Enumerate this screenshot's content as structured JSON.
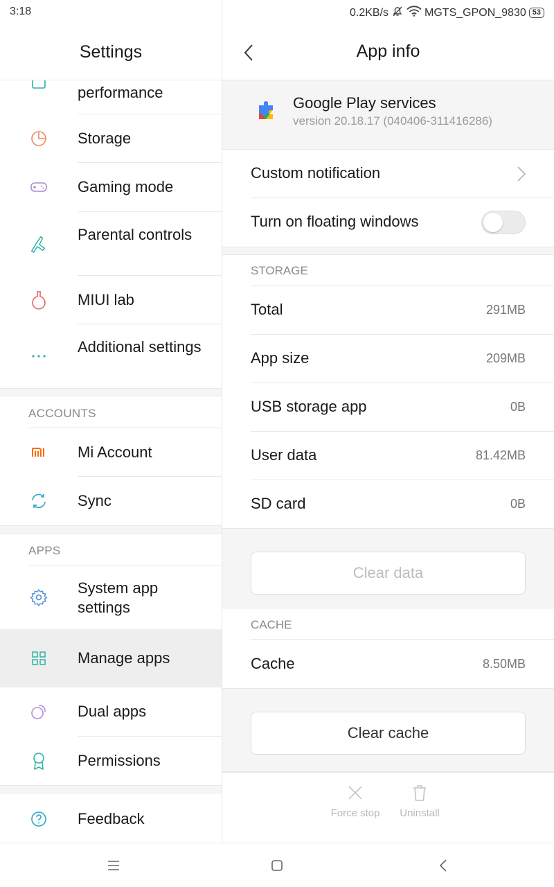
{
  "status_bar": {
    "time": "3:18",
    "speed": "0.2KB/s",
    "network": "MGTS_GPON_9830",
    "battery": "53"
  },
  "settings": {
    "title": "Settings",
    "items_top": [
      {
        "label": "performance",
        "icon": "battery-performance-icon"
      },
      {
        "label": "Storage",
        "icon": "storage-pie-icon"
      },
      {
        "label": "Gaming mode",
        "icon": "gamepad-icon"
      },
      {
        "label": "Parental controls",
        "icon": "parental-controls-icon"
      },
      {
        "label": "MIUI lab",
        "icon": "flask-icon"
      },
      {
        "label": "Additional settings",
        "icon": "more-dots-icon"
      }
    ],
    "accounts_header": "ACCOUNTS",
    "accounts": [
      {
        "label": "Mi Account",
        "icon": "mi-logo-icon"
      },
      {
        "label": "Sync",
        "icon": "sync-icon"
      }
    ],
    "apps_header": "APPS",
    "apps": [
      {
        "label": "System app settings",
        "icon": "gear-icon"
      },
      {
        "label": "Manage apps",
        "icon": "grid-icon"
      },
      {
        "label": "Dual apps",
        "icon": "dual-apps-icon"
      },
      {
        "label": "Permissions",
        "icon": "permissions-badge-icon"
      }
    ],
    "feedback": {
      "label": "Feedback",
      "icon": "question-icon"
    }
  },
  "app_info": {
    "title": "App  info",
    "app_name": "Google Play services",
    "version": "version 20.18.17 (040406-311416286)",
    "custom_notification": "Custom notification",
    "floating_windows": "Turn on floating windows",
    "floating_windows_on": false,
    "storage_header": "STORAGE",
    "storage": [
      {
        "label": "Total",
        "value": "291MB"
      },
      {
        "label": "App size",
        "value": "209MB"
      },
      {
        "label": "USB storage app",
        "value": "0B"
      },
      {
        "label": "User data",
        "value": "81.42MB"
      },
      {
        "label": "SD card",
        "value": "0B"
      }
    ],
    "clear_data": "Clear data",
    "cache_header": "CACHE",
    "cache_label": "Cache",
    "cache_value": "8.50MB",
    "clear_cache": "Clear cache",
    "force_stop": "Force stop",
    "uninstall": "Uninstall"
  },
  "colors": {
    "accent_teal": "#2bb3a3",
    "mi_orange": "#ff6900",
    "muted": "#8a8a8a"
  }
}
